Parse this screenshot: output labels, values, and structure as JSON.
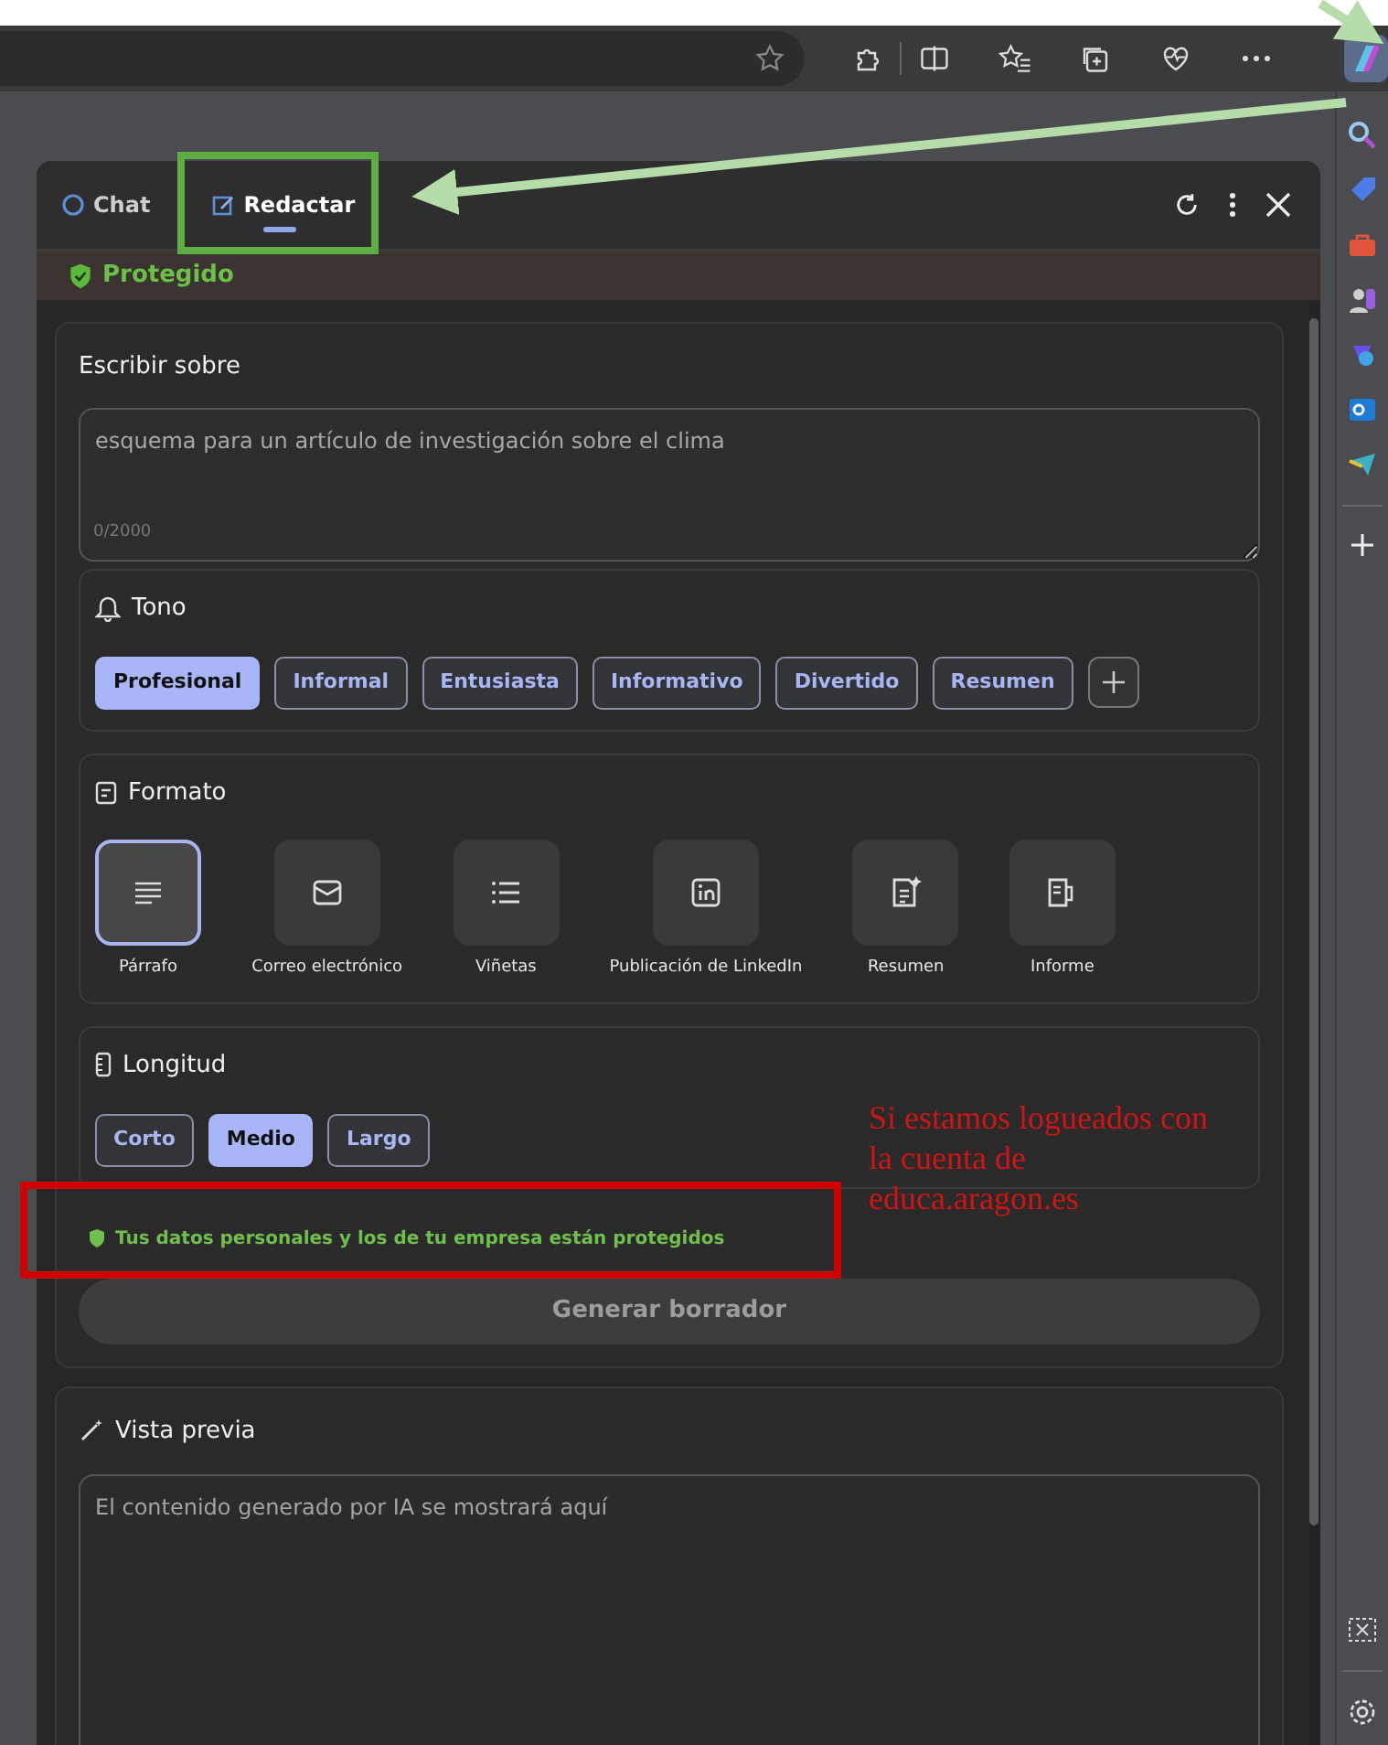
{
  "panel": {
    "tabs": [
      {
        "label": "Chat",
        "selected": false
      },
      {
        "label": "Redactar",
        "selected": true
      }
    ],
    "status": "Protegido",
    "write_about": {
      "label": "Escribir sobre",
      "placeholder": "esquema para un artículo de investigación sobre el clima",
      "counter": "0/2000"
    },
    "tone": {
      "label": "Tono",
      "options": [
        {
          "label": "Profesional",
          "selected": true
        },
        {
          "label": "Informal",
          "selected": false
        },
        {
          "label": "Entusiasta",
          "selected": false
        },
        {
          "label": "Informativo",
          "selected": false
        },
        {
          "label": "Divertido",
          "selected": false
        },
        {
          "label": "Resumen",
          "selected": false
        }
      ]
    },
    "format": {
      "label": "Formato",
      "options": [
        {
          "label": "Párrafo",
          "selected": true,
          "kind": "paragraph"
        },
        {
          "label": "Correo electrónico",
          "selected": false,
          "kind": "email"
        },
        {
          "label": "Viñetas",
          "selected": false,
          "kind": "bullets"
        },
        {
          "label": "Publicación de LinkedIn",
          "selected": false,
          "kind": "linkedin"
        },
        {
          "label": "Resumen",
          "selected": false,
          "kind": "summary"
        },
        {
          "label": "Informe",
          "selected": false,
          "kind": "report"
        }
      ]
    },
    "length": {
      "label": "Longitud",
      "options": [
        {
          "label": "Corto",
          "selected": false
        },
        {
          "label": "Medio",
          "selected": true
        },
        {
          "label": "Largo",
          "selected": false
        }
      ]
    },
    "privacy_note": "Tus datos personales y los de tu empresa están protegidos",
    "generate_button": {
      "label": "Generar borrador",
      "disabled": true
    },
    "preview": {
      "label": "Vista previa",
      "placeholder": "El contenido generado por IA se mostrará aquí"
    }
  },
  "annotation": {
    "note_lines": [
      "Si estamos logueados con",
      "la cuenta de",
      "educa.aragon.es"
    ]
  }
}
